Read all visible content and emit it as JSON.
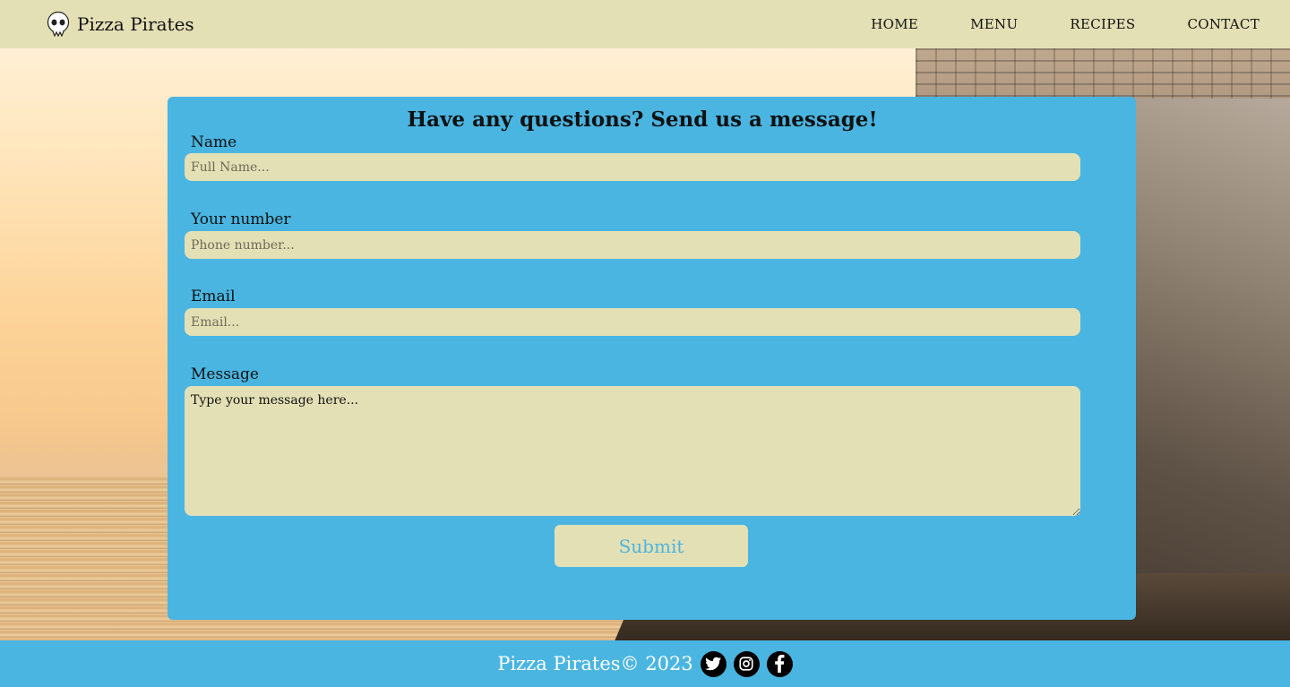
{
  "header": {
    "brand_name": "Pizza Pirates",
    "logo_icon": "skull-icon",
    "nav": [
      "HOME",
      "MENU",
      "RECIPES",
      "CONTACT"
    ]
  },
  "form": {
    "title": "Have any questions? Send us a message!",
    "fields": [
      {
        "label": "Name",
        "placeholder": "Full Name..."
      },
      {
        "label": "Your number",
        "placeholder": "Phone number..."
      },
      {
        "label": "Email",
        "placeholder": "Email..."
      }
    ],
    "message": {
      "label": "Message",
      "placeholder": "Type your message here..."
    },
    "submit_label": "Submit"
  },
  "footer": {
    "text": "Pizza Pirates© 2023",
    "social_icons": [
      "twitter-icon",
      "instagram-icon",
      "facebook-icon"
    ]
  },
  "colors": {
    "header_bg": "#e4e0b5",
    "accent_blue": "#4ab5e1",
    "input_bg": "#e4e0b5"
  }
}
